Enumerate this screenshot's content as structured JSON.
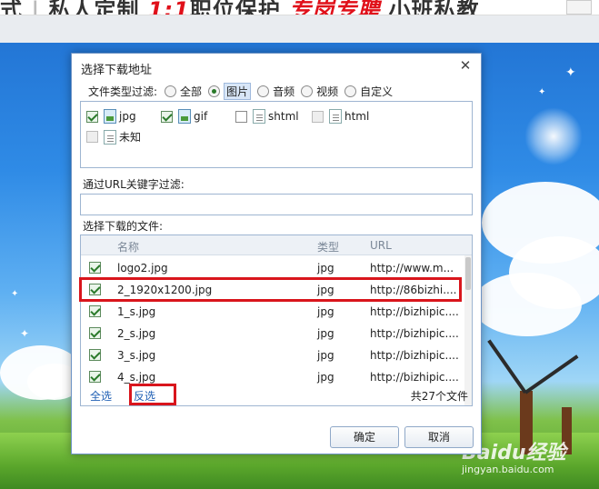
{
  "banner": {
    "text_parts": [
      "式",
      "私人定制",
      "1:1",
      "职位保护",
      "专岗专聘",
      "小班私教"
    ]
  },
  "watermark": {
    "logo": "Baidu经验",
    "url": "jingyan.baidu.com"
  },
  "dialog": {
    "title": "选择下载地址",
    "close_glyph": "✕",
    "filter": {
      "label": "文件类型过滤:",
      "options": [
        {
          "label": "全部",
          "selected": false
        },
        {
          "label": "图片",
          "selected": true
        },
        {
          "label": "音频",
          "selected": false
        },
        {
          "label": "视频",
          "selected": false
        },
        {
          "label": "自定义",
          "selected": false
        }
      ]
    },
    "types": [
      {
        "label": "jpg",
        "checked": true,
        "icon": "image-file-icon"
      },
      {
        "label": "gif",
        "checked": true,
        "icon": "image-file-icon"
      },
      {
        "label": "shtml",
        "checked": false,
        "icon": "document-file-icon"
      },
      {
        "label": "html",
        "checked": false,
        "icon": "document-file-icon"
      },
      {
        "label": "未知",
        "checked": false,
        "icon": "document-file-icon"
      }
    ],
    "url_filter": {
      "label": "通过URL关键字过滤:",
      "value": ""
    },
    "files": {
      "label": "选择下载的文件:",
      "columns": [
        "名称",
        "类型",
        "URL"
      ],
      "rows": [
        {
          "name": "logo2.jpg",
          "type": "jpg",
          "url": "http://www.m...",
          "checked": true
        },
        {
          "name": "2_1920x1200.jpg",
          "type": "jpg",
          "url": "http://86bizhi....",
          "checked": true
        },
        {
          "name": "1_s.jpg",
          "type": "jpg",
          "url": "http://bizhipic....",
          "checked": true
        },
        {
          "name": "2_s.jpg",
          "type": "jpg",
          "url": "http://bizhipic....",
          "checked": true
        },
        {
          "name": "3_s.jpg",
          "type": "jpg",
          "url": "http://bizhipic....",
          "checked": true
        },
        {
          "name": "4_s.jpg",
          "type": "jpg",
          "url": "http://bizhipic....",
          "checked": true
        }
      ]
    },
    "select_all": "全选",
    "invert_selection": "反选",
    "file_count": "共27个文件",
    "ok_label": "确定",
    "cancel_label": "取消"
  },
  "colors": {
    "highlight": "#d9151c",
    "link": "#1f5fb4",
    "dialog_border": "#6d93c5"
  }
}
